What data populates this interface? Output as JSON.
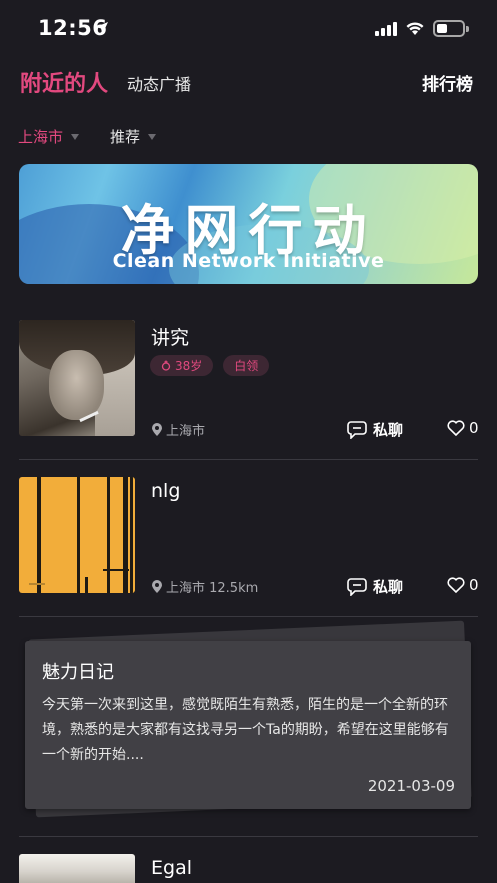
{
  "status_bar": {
    "time": "12:56",
    "icons": [
      "location-arrow-icon",
      "signal-icon",
      "wifi-icon",
      "battery-icon"
    ]
  },
  "nav": {
    "active_tab": "附近的人",
    "tab2": "动态广播",
    "rank": "排行榜"
  },
  "filters": {
    "city": "上海市",
    "recommend": "推荐"
  },
  "banner": {
    "title": "净网行动",
    "subtitle": "Clean Network Initiative"
  },
  "users": [
    {
      "name": "讲究",
      "age": "38岁",
      "job": "白领",
      "location": "上海市",
      "chat_label": "私聊",
      "likes": "0"
    },
    {
      "name": "nlg",
      "location": "上海市 12.5km",
      "chat_label": "私聊",
      "likes": "0"
    },
    {
      "name": "Egal"
    }
  ],
  "diary": {
    "title": "魅力日记",
    "text": "今天第一次来到这里，感觉既陌生有熟悉，陌生的是一个全新的环境，熟悉的是大家都有这找寻另一个Ta的期盼，希望在这里能够有一个新的开始....",
    "date": "2021-03-09"
  },
  "colors": {
    "background": "#1c1b21",
    "accent": "#e2497f",
    "tag_bg": "#3d2733",
    "diary_card": "#414045"
  }
}
